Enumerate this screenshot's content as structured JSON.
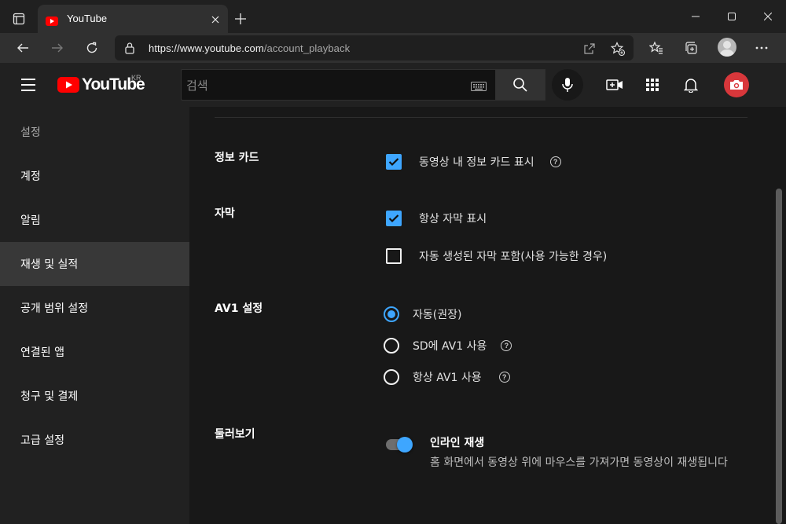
{
  "browser": {
    "tab_title": "YouTube",
    "url_host": "https://www.youtube.com",
    "url_path": "/account_playback"
  },
  "youtube": {
    "logo_text": "YouTube",
    "region": "KR",
    "search_placeholder": "검색"
  },
  "sidebar": {
    "heading": "설정",
    "items": [
      {
        "label": "계정",
        "active": false
      },
      {
        "label": "알림",
        "active": false
      },
      {
        "label": "재생 및 실적",
        "active": true
      },
      {
        "label": "공개 범위 설정",
        "active": false
      },
      {
        "label": "연결된 앱",
        "active": false
      },
      {
        "label": "청구 및 결제",
        "active": false
      },
      {
        "label": "고급 설정",
        "active": false
      }
    ]
  },
  "settings": {
    "info_cards": {
      "label": "정보 카드",
      "option": "동영상 내 정보 카드 표시",
      "checked": true
    },
    "captions": {
      "label": "자막",
      "options": [
        {
          "text": "항상 자막 표시",
          "checked": true
        },
        {
          "text": "자동 생성된 자막 포함(사용 가능한 경우)",
          "checked": false
        }
      ]
    },
    "av1": {
      "label": "AV1 설정",
      "options": [
        {
          "text": "자동(권장)",
          "selected": true
        },
        {
          "text": "SD에 AV1 사용",
          "selected": false
        },
        {
          "text": "항상 AV1 사용",
          "selected": false
        }
      ]
    },
    "browse": {
      "label": "둘러보기",
      "toggle_title": "인라인 재생",
      "toggle_desc": "홈 화면에서 동영상 위에 마우스를 가져가면 동영상이 재생됩니다",
      "enabled": true
    }
  },
  "colors": {
    "accent": "#3ea6ff",
    "brand_red": "#ff0000",
    "background": "#181818",
    "sidebar_bg": "#212121"
  }
}
